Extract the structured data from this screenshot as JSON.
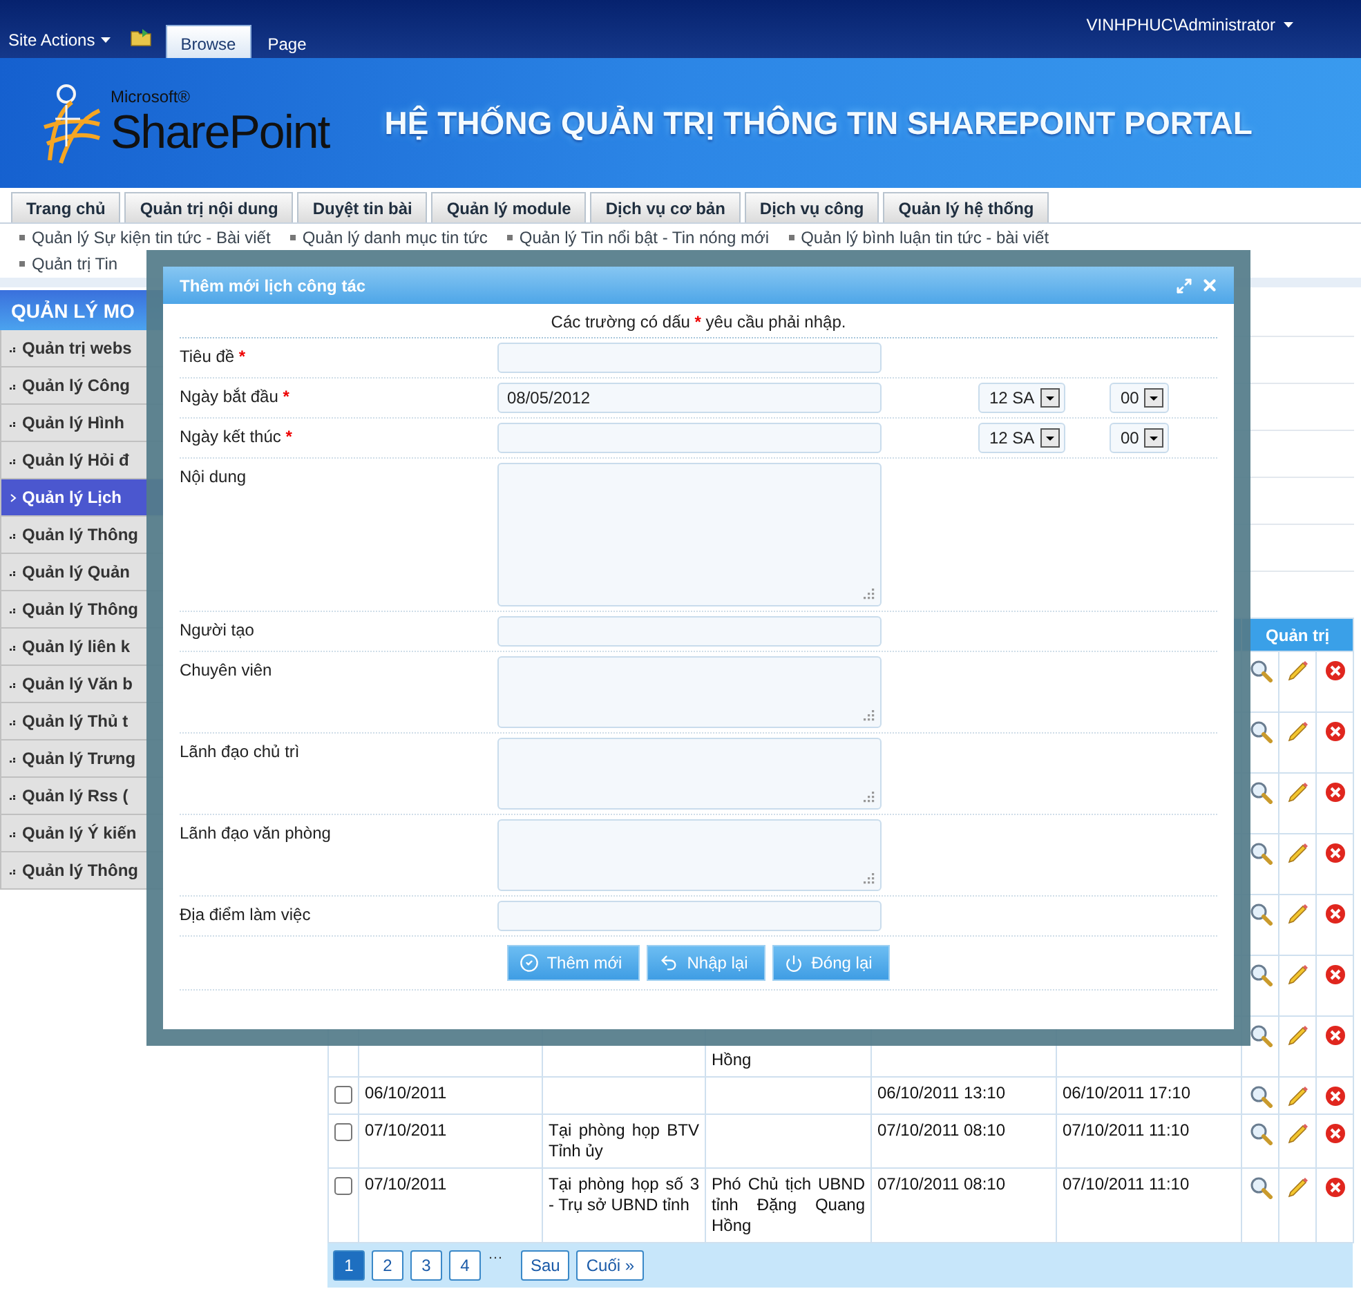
{
  "top_bar": {
    "site_actions": "Site Actions",
    "tabs": [
      {
        "label": "Browse",
        "selected": true
      },
      {
        "label": "Page",
        "selected": false
      }
    ],
    "user": "VINHPHUC\\Administrator"
  },
  "banner": {
    "logo_small": "Microsoft®",
    "logo_big": "SharePoint",
    "title": "HỆ THỐNG QUẢN TRỊ THÔNG TIN SHAREPOINT PORTAL"
  },
  "nav": [
    "Trang chủ",
    "Quản trị nội dung",
    "Duyệt tin bài",
    "Quản lý module",
    "Dịch vụ cơ bản",
    "Dịch vụ công",
    "Quản lý hệ thống"
  ],
  "subnav": [
    {
      "items": [
        "Quản lý Sự kiện tin tức - Bài viết",
        "Quản lý danh mục tin tức",
        "Quản lý Tin nổi bật - Tin nóng mới",
        "Quản lý bình luận tin tức - bài viết"
      ]
    },
    {
      "items": [
        "Quản trị Tin"
      ]
    }
  ],
  "sidebar": {
    "title": "QUẢN LÝ MO",
    "items": [
      {
        "label": "Quản trị webs",
        "selected": false
      },
      {
        "label": "Quản lý Công",
        "selected": false
      },
      {
        "label": "Quản lý Hình",
        "selected": false
      },
      {
        "label": "Quản lý Hỏi đ",
        "selected": false
      },
      {
        "label": "Quản lý Lịch",
        "selected": true
      },
      {
        "label": "Quản lý Thông",
        "selected": false
      },
      {
        "label": "Quản lý Quản",
        "selected": false
      },
      {
        "label": "Quản lý Thông",
        "selected": false
      },
      {
        "label": "Quản lý liên k",
        "selected": false
      },
      {
        "label": "Quản lý Văn b",
        "selected": false
      },
      {
        "label": "Quản lý Thủ t",
        "selected": false
      },
      {
        "label": "Quản lý Trưng",
        "selected": false
      },
      {
        "label": "Quản lý Rss (",
        "selected": false
      },
      {
        "label": "Quản lý Ý kiến",
        "selected": false
      },
      {
        "label": "Quản lý Thông",
        "selected": false
      }
    ]
  },
  "table": {
    "header": "Quản trị",
    "rows": [
      {},
      {},
      {},
      {},
      {},
      {},
      {
        "person": "Hồng"
      },
      {
        "checked": false,
        "date": "06/10/2011",
        "start": "06/10/2011 13:10",
        "end": "06/10/2011 17:10"
      },
      {
        "checked": false,
        "date": "07/10/2011",
        "place": "Tại phòng họp BTV Tỉnh ủy",
        "start": "07/10/2011 08:10",
        "end": "07/10/2011 11:10"
      },
      {
        "checked": false,
        "date": "07/10/2011",
        "place": "Tại phòng họp số 3 - Trụ sở UBND tỉnh",
        "person": "Phó Chủ tịch UBND tỉnh Đặng Quang Hồng",
        "start": "07/10/2011 08:10",
        "end": "07/10/2011 11:10"
      }
    ]
  },
  "pagination": {
    "pages": [
      {
        "label": "1",
        "selected": true
      },
      {
        "label": "2",
        "selected": false
      },
      {
        "label": "3",
        "selected": false
      },
      {
        "label": "4",
        "selected": false
      }
    ],
    "ellipsis": "…",
    "next": "Sau",
    "last": "Cuối »"
  },
  "dialog": {
    "title": "Thêm mới lịch công tác",
    "note": {
      "text": "Các trường có dấu",
      "mark": "*",
      "rest": "yêu cầu phải nhập."
    },
    "fields": [
      {
        "kind": "text",
        "label": "Tiêu đề",
        "required": true
      },
      {
        "kind": "date",
        "label": "Ngày bắt đầu",
        "required": true,
        "value": "08/05/2012",
        "hour": "12 SA",
        "minute": "00"
      },
      {
        "kind": "date",
        "label": "Ngày kết thúc",
        "required": true,
        "hour": "12 SA",
        "minute": "00"
      },
      {
        "kind": "memo",
        "label": "Nội dung",
        "required": false
      },
      {
        "kind": "text",
        "label": "Người tạo",
        "required": false
      },
      {
        "kind": "textarea",
        "label": "Chuyên viên",
        "required": false
      },
      {
        "kind": "textarea",
        "label": "Lãnh đạo chủ trì",
        "required": false
      },
      {
        "kind": "textarea",
        "label": "Lãnh đạo văn phòng",
        "required": false
      },
      {
        "kind": "text",
        "label": "Địa điểm làm việc",
        "required": false
      }
    ],
    "buttons": [
      {
        "kind": "submit",
        "label": "Thêm mới"
      },
      {
        "kind": "reset",
        "label": "Nhập lại"
      },
      {
        "kind": "close",
        "label": "Đóng lại"
      }
    ]
  }
}
